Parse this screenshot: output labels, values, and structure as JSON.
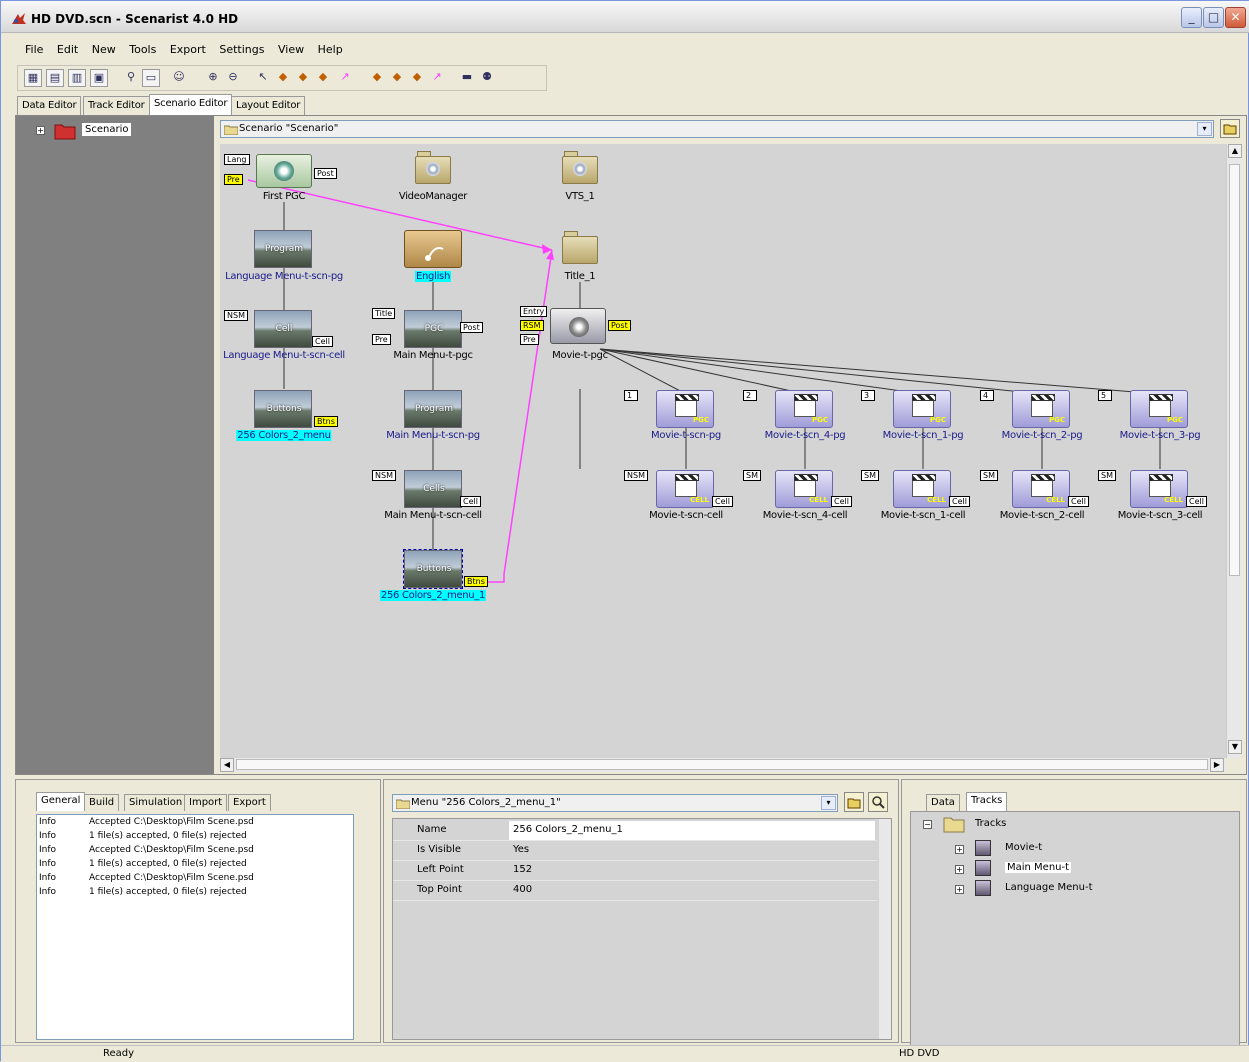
{
  "window": {
    "title": "HD DVD.scn - Scenarist 4.0 HD",
    "min": "_",
    "max": "□",
    "close": "✕"
  },
  "menu": [
    "File",
    "Edit",
    "New",
    "Tools",
    "Export",
    "Settings",
    "View",
    "Help"
  ],
  "tabs": [
    "Data Editor",
    "Track Editor",
    "Scenario Editor",
    "Layout Editor"
  ],
  "active_tab": "Scenario Editor",
  "tree": {
    "root": "Scenario",
    "expander": "+"
  },
  "editor": {
    "path": "Scenario \"Scenario\"",
    "dropdown": "▾"
  },
  "canvas": {
    "nodes": {
      "first_pgc": "First PGC",
      "video_manager": "VideoManager",
      "vts_1": "VTS_1",
      "language_menu_pg": "Language Menu-t-scn-pg",
      "english": "English",
      "title_1": "Title_1",
      "language_menu_cell": "Language Menu-t-scn-cell",
      "main_menu_pgc": "Main Menu-t-pgc",
      "movie_pgc": "Movie-t-pgc",
      "menu_256": "256 Colors_2_menu",
      "main_menu_pg": "Main Menu-t-scn-pg",
      "main_menu_cell": "Main Menu-t-scn-cell",
      "menu_256_1": "256 Colors_2_menu_1"
    },
    "movie_pgs": [
      {
        "num": "1",
        "pg": "Movie-t-scn-pg",
        "sm": "NSM",
        "cell": "Movie-t-scn-cell"
      },
      {
        "num": "2",
        "pg": "Movie-t-scn_4-pg",
        "sm": "SM",
        "cell": "Movie-t-scn_4-cell"
      },
      {
        "num": "3",
        "pg": "Movie-t-scn_1-pg",
        "sm": "SM",
        "cell": "Movie-t-scn_1-cell"
      },
      {
        "num": "4",
        "pg": "Movie-t-scn_2-pg",
        "sm": "SM",
        "cell": "Movie-t-scn_2-cell"
      },
      {
        "num": "5",
        "pg": "Movie-t-scn_3-pg",
        "sm": "SM",
        "cell": "Movie-t-scn_3-cell"
      }
    ],
    "ports": {
      "lang": "Lang",
      "post": "Post",
      "pre": "Pre",
      "nsm": "NSM",
      "cell": "Cell",
      "btns": "Btns",
      "title": "Title",
      "entry": "Entry",
      "rsm": "RSM",
      "pgc": "PGC",
      "thumb_program": "Program",
      "thumb_cell": "Cell",
      "thumb_buttons": "Buttons",
      "thumb_cells": "Cells",
      "thumb_buttons2": "Buttons",
      "pgc_tag": "PGC",
      "cell_tag": "CELL"
    }
  },
  "log_panel": {
    "tabs": [
      "General",
      "Build",
      "Simulation",
      "Import",
      "Export"
    ],
    "active_tab": "General",
    "rows": [
      {
        "level": "Info",
        "msg": "Accepted C:\\Desktop\\Film Scene.psd"
      },
      {
        "level": "Info",
        "msg": "1 file(s) accepted, 0 file(s) rejected"
      },
      {
        "level": "Info",
        "msg": "Accepted C:\\Desktop\\Film Scene.psd"
      },
      {
        "level": "Info",
        "msg": "1 file(s) accepted, 0 file(s) rejected"
      },
      {
        "level": "Info",
        "msg": "Accepted C:\\Desktop\\Film Scene.psd"
      },
      {
        "level": "Info",
        "msg": "1 file(s) accepted, 0 file(s) rejected"
      }
    ]
  },
  "props_panel": {
    "selector": "Menu \"256 Colors_2_menu_1\"",
    "rows": [
      {
        "key": "Name",
        "value": "256 Colors_2_menu_1"
      },
      {
        "key": "Is Visible",
        "value": "Yes"
      },
      {
        "key": "Left Point",
        "value": "152"
      },
      {
        "key": "Top Point",
        "value": "400"
      }
    ]
  },
  "tracks_panel": {
    "tabs": [
      "Data",
      "Tracks"
    ],
    "active_tab": "Tracks",
    "root": "Tracks",
    "items": [
      "Movie-t",
      "Main Menu-t",
      "Language Menu-t"
    ]
  },
  "status": {
    "left": "Ready",
    "right": "HD DVD"
  },
  "colors": {
    "accent_link": "#ff40ff",
    "highlight": "#00ffff",
    "port_yellow": "#ffff00"
  }
}
